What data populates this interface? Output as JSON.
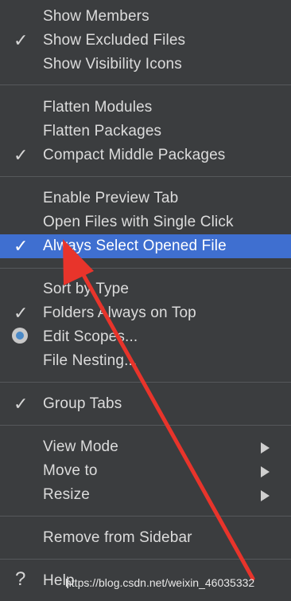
{
  "menu": {
    "items": [
      {
        "label": "Show Members",
        "checked": false
      },
      {
        "label": "Show Excluded Files",
        "checked": true
      },
      {
        "label": "Show Visibility Icons",
        "checked": false
      },
      {
        "label": "Flatten Modules",
        "checked": false
      },
      {
        "label": "Flatten Packages",
        "checked": false
      },
      {
        "label": "Compact Middle Packages",
        "checked": true
      },
      {
        "label": "Enable Preview Tab",
        "checked": false
      },
      {
        "label": "Open Files with Single Click",
        "checked": false
      },
      {
        "label": "Always Select Opened File",
        "checked": true,
        "selected": true
      },
      {
        "label": "Sort by Type",
        "checked": false
      },
      {
        "label": "Folders Always on Top",
        "checked": true
      },
      {
        "label": "Edit Scopes...",
        "radio": true
      },
      {
        "label": "File Nesting...",
        "checked": false
      },
      {
        "label": "Group Tabs",
        "checked": true
      },
      {
        "label": "View Mode",
        "submenu": true
      },
      {
        "label": "Move to",
        "submenu": true
      },
      {
        "label": "Resize",
        "submenu": true
      },
      {
        "label": "Remove from Sidebar",
        "checked": false
      },
      {
        "label": "Help",
        "icon": "question-mark-icon"
      }
    ]
  },
  "glyphs": {
    "check": "✓",
    "help": "?"
  },
  "watermark": "https://blog.csdn.net/weixin_46035332",
  "colors": {
    "background": "#3b3d3f",
    "selection": "#3f6fd0",
    "annotation_arrow": "#e8342b"
  }
}
